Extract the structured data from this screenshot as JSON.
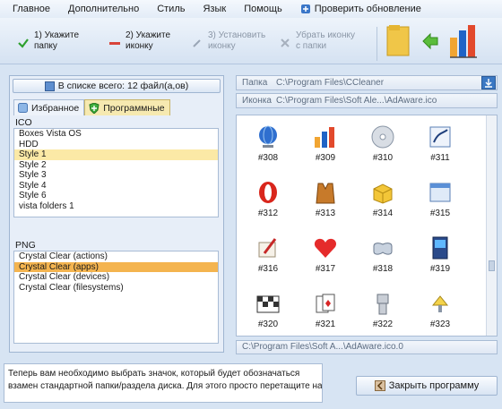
{
  "menu": {
    "items": [
      "Главное",
      "Дополнительно",
      "Стиль",
      "Язык",
      "Помощь"
    ],
    "update_label": "Проверить обновление"
  },
  "toolbar": {
    "step1": "1) Укажите\nпапку",
    "step2": "2) Укажите\nиконку",
    "step3": "3) Установить\nиконку",
    "remove": "Убрать иконку\nс папки"
  },
  "left": {
    "count_label": "В списке всего: 12 файл(а,ов)",
    "tabs": [
      "Избранное",
      "Программные"
    ],
    "ico_head": "ICO",
    "ico_items": [
      "Boxes Vista OS",
      "HDD",
      "Style 1",
      "Style 2",
      "Style 3",
      "Style 4",
      "Style 6",
      "vista folders 1"
    ],
    "png_head": "PNG",
    "png_items": [
      "Crystal Clear (actions)",
      "Crystal Clear (apps)",
      "Crystal Clear (devices)",
      "Crystal Clear (filesystems)"
    ]
  },
  "right": {
    "folder_label": "Папка",
    "folder_value": "C:\\Program Files\\CCleaner",
    "icon_label": "Иконка",
    "icon_value": "C:\\Program Files\\Soft Ale...\\AdAware.ico",
    "icons": [
      "#308",
      "#309",
      "#310",
      "#311",
      "#312",
      "#313",
      "#314",
      "#315",
      "#316",
      "#317",
      "#318",
      "#319",
      "#320",
      "#321",
      "#322",
      "#323"
    ],
    "bottom_path": "C:\\Program Files\\Soft A...\\AdAware.ico.0"
  },
  "status": {
    "line1": "Теперь вам необходимо выбрать значок, который будет обозначаться",
    "line2": "взамен стандартной папки/раздела диска. Для этого просто перетащите на"
  },
  "close_label": "Закрыть программу",
  "colors": {
    "accent": "#2a7be0",
    "selection_light": "#fbe9a6",
    "selection_strong": "#f4b44f",
    "panel_bg": "#d7e4f3"
  }
}
